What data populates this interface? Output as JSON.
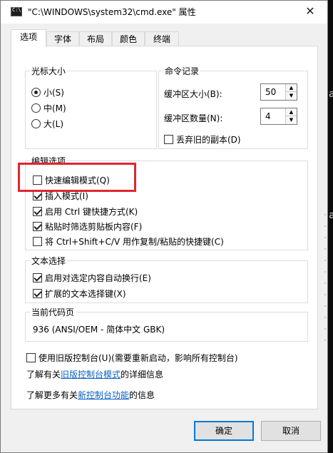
{
  "window": {
    "title": "\"C:\\WINDOWS\\system32\\cmd.exe\" 属性",
    "close_glyph": "✕"
  },
  "tabs": [
    {
      "label": "选项",
      "active": true
    },
    {
      "label": "字体",
      "active": false
    },
    {
      "label": "布局",
      "active": false
    },
    {
      "label": "颜色",
      "active": false
    },
    {
      "label": "终端",
      "active": false
    }
  ],
  "cursor_size": {
    "label": "光标大小",
    "options": [
      {
        "label": "小(S)",
        "checked": true
      },
      {
        "label": "中(M)",
        "checked": false
      },
      {
        "label": "大(L)",
        "checked": false
      }
    ]
  },
  "command_history": {
    "label": "命令记录",
    "buffer_size_label": "缓冲区大小(B):",
    "buffer_size_value": "50",
    "buffer_count_label": "缓冲区数量(N):",
    "buffer_count_value": "4",
    "discard_label": "丢弃旧的副本(D)",
    "discard_checked": false
  },
  "edit_options": {
    "label": "编辑选项",
    "items": [
      {
        "label": "快速编辑模式(Q)",
        "checked": false
      },
      {
        "label": "插入模式(I)",
        "checked": true
      },
      {
        "label": "启用 Ctrl 键快捷方式(K)",
        "checked": true
      },
      {
        "label": "粘贴时筛选剪贴板内容(F)",
        "checked": true
      },
      {
        "label": "将 Ctrl+Shift+C/V 用作复制/粘贴的快捷键(C)",
        "checked": false
      }
    ]
  },
  "text_selection": {
    "label": "文本选择",
    "items": [
      {
        "label": "启用对选定内容自动换行(E)",
        "checked": true
      },
      {
        "label": "扩展的文本选择键(X)",
        "checked": true
      }
    ]
  },
  "code_page": {
    "label": "当前代码页",
    "value": "936   (ANSI/OEM - 简体中文 GBK)"
  },
  "legacy": {
    "label": "使用旧版控制台(U)(需要重新启动，影响所有控制台)",
    "checked": false,
    "info_prefix": "了解有关",
    "info_link": "旧版控制台模式",
    "info_suffix": "的详细信息",
    "more_prefix": "了解更多有关",
    "more_link": "新控制台功能",
    "more_suffix": "的信息"
  },
  "buttons": {
    "ok": "确定",
    "cancel": "取消"
  },
  "background": {
    "chars": [
      "a",
      "a",
      "8",
      "8",
      "8"
    ]
  },
  "colors": {
    "highlight": "#e0262e",
    "link": "#0b63c6",
    "primary_border": "#0078d7"
  }
}
